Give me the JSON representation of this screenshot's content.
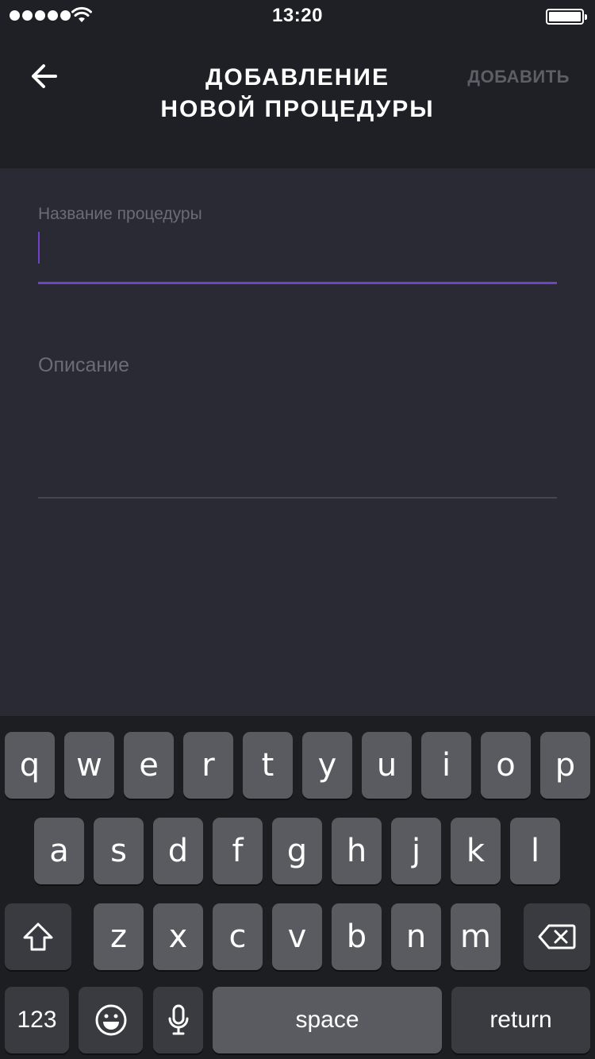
{
  "status_bar": {
    "time": "13:20",
    "signal_icon": "signal-dots-icon",
    "wifi_icon": "wifi-icon",
    "battery_icon": "battery-icon",
    "battery_level": 1.0
  },
  "nav": {
    "back_icon": "arrow-left-icon",
    "title_line1": "ДОБАВЛЕНИЕ",
    "title_line2": "НОВОЙ ПРОЦЕДУРЫ",
    "add_label": "ДОБАВИТЬ"
  },
  "form": {
    "name_label": "Название процедуры",
    "name_value": "",
    "description_label": "Описание",
    "description_value": "",
    "accent_color": "#7041c9"
  },
  "keyboard": {
    "row1": [
      "q",
      "w",
      "e",
      "r",
      "t",
      "y",
      "u",
      "i",
      "o",
      "p"
    ],
    "row2": [
      "a",
      "s",
      "d",
      "f",
      "g",
      "h",
      "j",
      "k",
      "l"
    ],
    "row3": [
      "z",
      "x",
      "c",
      "v",
      "b",
      "n",
      "m"
    ],
    "shift_icon": "shift-icon",
    "backspace_icon": "backspace-icon",
    "numbers_label": "123",
    "emoji_icon": "emoji-icon",
    "mic_icon": "microphone-icon",
    "space_label": "space",
    "return_label": "return"
  }
}
